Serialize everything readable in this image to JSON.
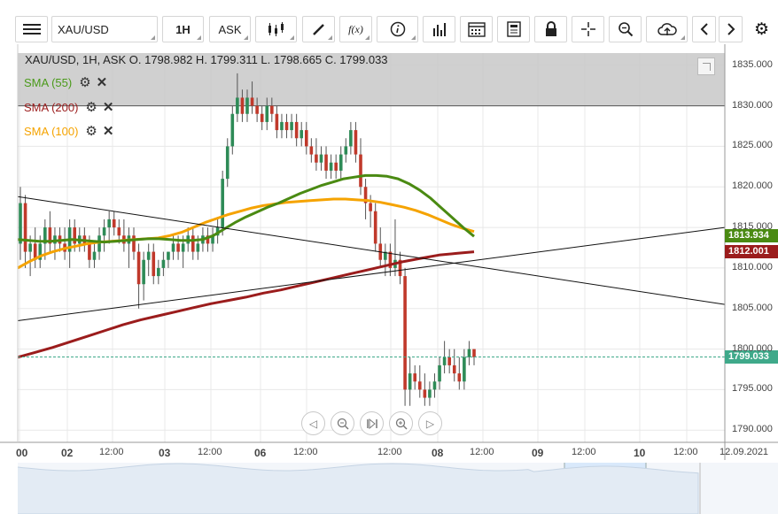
{
  "toolbar": {
    "symbol": "XAU/USD",
    "timeframe": "1H",
    "price_type": "ASK",
    "fx_label": "f(x)"
  },
  "chart_header": {
    "info": "XAU/USD, 1H, ASK   O. 1798.982 H. 1799.311 L. 1798.665 C. 1799.033"
  },
  "indicators": [
    {
      "label": "SMA (55)",
      "color": "#4a9a1a"
    },
    {
      "label": "SMA (200)",
      "color": "#9b1c1c"
    },
    {
      "label": "SMA (100)",
      "color": "#f5a300"
    }
  ],
  "price_badges": [
    {
      "label": "1813.934",
      "value": 1813.934,
      "color": "#4a8a12"
    },
    {
      "label": "1812.001",
      "value": 1812.001,
      "color": "#9b1c1c"
    },
    {
      "label": "1799.033",
      "value": 1799.033,
      "color": "#3fa98a"
    }
  ],
  "colors": {
    "bull_candle": "#2e8b57",
    "bear_candle": "#c0392b",
    "trendline": "#111111",
    "shaded_zone": "#c8c8c8",
    "grid": "#e8e8e8"
  },
  "chart_data": {
    "type": "candlestick",
    "symbol": "XAU/USD",
    "timeframe": "1H",
    "y_ticks": [
      "1835.000",
      "1830.000",
      "1825.000",
      "1820.000",
      "1815.000",
      "1810.000",
      "1805.000",
      "1800.000",
      "1795.000",
      "1790.000"
    ],
    "ylim": [
      1788.5,
      1836.5
    ],
    "x_ticks": [
      "00",
      "02",
      "12:00",
      "03",
      "12:00",
      "06",
      "12:00",
      "12:00",
      "08",
      "12:00",
      "09",
      "12:00",
      "10",
      "12:00",
      "12.09.2021"
    ],
    "shaded_zone": [
      1830.0,
      1836.5
    ],
    "current_price": 1799.033,
    "candles": [
      {
        "o": 1813,
        "h": 1820,
        "l": 1811,
        "c": 1818
      },
      {
        "o": 1818,
        "h": 1819,
        "l": 1810,
        "c": 1812
      },
      {
        "o": 1812,
        "h": 1814,
        "l": 1809,
        "c": 1813
      },
      {
        "o": 1813,
        "h": 1815,
        "l": 1810,
        "c": 1811
      },
      {
        "o": 1811,
        "h": 1814,
        "l": 1810,
        "c": 1813
      },
      {
        "o": 1813,
        "h": 1816,
        "l": 1811,
        "c": 1815
      },
      {
        "o": 1815,
        "h": 1817,
        "l": 1812,
        "c": 1813
      },
      {
        "o": 1813,
        "h": 1815,
        "l": 1811,
        "c": 1814
      },
      {
        "o": 1814,
        "h": 1815,
        "l": 1812,
        "c": 1813
      },
      {
        "o": 1813,
        "h": 1815,
        "l": 1811,
        "c": 1812
      },
      {
        "o": 1812,
        "h": 1816,
        "l": 1810,
        "c": 1815
      },
      {
        "o": 1815,
        "h": 1816,
        "l": 1812,
        "c": 1813
      },
      {
        "o": 1813,
        "h": 1815,
        "l": 1812,
        "c": 1814
      },
      {
        "o": 1814,
        "h": 1815,
        "l": 1812,
        "c": 1813
      },
      {
        "o": 1813,
        "h": 1814,
        "l": 1810,
        "c": 1811
      },
      {
        "o": 1811,
        "h": 1813,
        "l": 1810,
        "c": 1812
      },
      {
        "o": 1812,
        "h": 1815,
        "l": 1811,
        "c": 1814
      },
      {
        "o": 1814,
        "h": 1816,
        "l": 1812,
        "c": 1815
      },
      {
        "o": 1815,
        "h": 1817,
        "l": 1813,
        "c": 1816
      },
      {
        "o": 1816,
        "h": 1817,
        "l": 1814,
        "c": 1815
      },
      {
        "o": 1815,
        "h": 1816,
        "l": 1813,
        "c": 1814
      },
      {
        "o": 1814,
        "h": 1816,
        "l": 1812,
        "c": 1813
      },
      {
        "o": 1813,
        "h": 1815,
        "l": 1810,
        "c": 1814
      },
      {
        "o": 1814,
        "h": 1815,
        "l": 1811,
        "c": 1812
      },
      {
        "o": 1812,
        "h": 1813,
        "l": 1805,
        "c": 1808
      },
      {
        "o": 1808,
        "h": 1812,
        "l": 1806,
        "c": 1811
      },
      {
        "o": 1811,
        "h": 1813,
        "l": 1809,
        "c": 1812
      },
      {
        "o": 1812,
        "h": 1813,
        "l": 1808,
        "c": 1809
      },
      {
        "o": 1809,
        "h": 1811,
        "l": 1808,
        "c": 1810
      },
      {
        "o": 1810,
        "h": 1812,
        "l": 1809,
        "c": 1811
      },
      {
        "o": 1811,
        "h": 1812,
        "l": 1810,
        "c": 1812
      },
      {
        "o": 1812,
        "h": 1814,
        "l": 1811,
        "c": 1813
      },
      {
        "o": 1813,
        "h": 1814,
        "l": 1811,
        "c": 1812
      },
      {
        "o": 1812,
        "h": 1814,
        "l": 1810,
        "c": 1813
      },
      {
        "o": 1813,
        "h": 1815,
        "l": 1812,
        "c": 1814
      },
      {
        "o": 1814,
        "h": 1815,
        "l": 1811,
        "c": 1812
      },
      {
        "o": 1812,
        "h": 1814,
        "l": 1811,
        "c": 1813
      },
      {
        "o": 1813,
        "h": 1815,
        "l": 1812,
        "c": 1814
      },
      {
        "o": 1814,
        "h": 1815,
        "l": 1812,
        "c": 1813
      },
      {
        "o": 1813,
        "h": 1815,
        "l": 1812,
        "c": 1814
      },
      {
        "o": 1814,
        "h": 1816,
        "l": 1813,
        "c": 1815
      },
      {
        "o": 1815,
        "h": 1822,
        "l": 1814,
        "c": 1821
      },
      {
        "o": 1821,
        "h": 1826,
        "l": 1820,
        "c": 1825
      },
      {
        "o": 1825,
        "h": 1830,
        "l": 1824,
        "c": 1829
      },
      {
        "o": 1829,
        "h": 1834,
        "l": 1828,
        "c": 1831
      },
      {
        "o": 1831,
        "h": 1832,
        "l": 1828,
        "c": 1829
      },
      {
        "o": 1829,
        "h": 1832,
        "l": 1828,
        "c": 1831
      },
      {
        "o": 1831,
        "h": 1833,
        "l": 1829,
        "c": 1830
      },
      {
        "o": 1830,
        "h": 1831,
        "l": 1828,
        "c": 1829
      },
      {
        "o": 1829,
        "h": 1830,
        "l": 1827,
        "c": 1828
      },
      {
        "o": 1828,
        "h": 1831,
        "l": 1827,
        "c": 1830
      },
      {
        "o": 1830,
        "h": 1831,
        "l": 1828,
        "c": 1829
      },
      {
        "o": 1829,
        "h": 1830,
        "l": 1826,
        "c": 1827
      },
      {
        "o": 1827,
        "h": 1829,
        "l": 1826,
        "c": 1828
      },
      {
        "o": 1828,
        "h": 1829,
        "l": 1826,
        "c": 1827
      },
      {
        "o": 1827,
        "h": 1829,
        "l": 1826,
        "c": 1828
      },
      {
        "o": 1828,
        "h": 1829,
        "l": 1825,
        "c": 1826
      },
      {
        "o": 1826,
        "h": 1828,
        "l": 1825,
        "c": 1827
      },
      {
        "o": 1827,
        "h": 1828,
        "l": 1824,
        "c": 1825
      },
      {
        "o": 1825,
        "h": 1826,
        "l": 1823,
        "c": 1824
      },
      {
        "o": 1824,
        "h": 1826,
        "l": 1822,
        "c": 1823
      },
      {
        "o": 1823,
        "h": 1825,
        "l": 1822,
        "c": 1824
      },
      {
        "o": 1824,
        "h": 1825,
        "l": 1821,
        "c": 1822
      },
      {
        "o": 1822,
        "h": 1824,
        "l": 1821,
        "c": 1823
      },
      {
        "o": 1823,
        "h": 1824,
        "l": 1821,
        "c": 1822
      },
      {
        "o": 1822,
        "h": 1825,
        "l": 1821,
        "c": 1824
      },
      {
        "o": 1824,
        "h": 1826,
        "l": 1823,
        "c": 1825
      },
      {
        "o": 1825,
        "h": 1828,
        "l": 1824,
        "c": 1827
      },
      {
        "o": 1827,
        "h": 1828,
        "l": 1823,
        "c": 1824
      },
      {
        "o": 1824,
        "h": 1826,
        "l": 1819,
        "c": 1820
      },
      {
        "o": 1820,
        "h": 1821,
        "l": 1816,
        "c": 1818
      },
      {
        "o": 1818,
        "h": 1819,
        "l": 1815,
        "c": 1817
      },
      {
        "o": 1817,
        "h": 1818,
        "l": 1812,
        "c": 1813
      },
      {
        "o": 1813,
        "h": 1815,
        "l": 1810,
        "c": 1811
      },
      {
        "o": 1811,
        "h": 1813,
        "l": 1809,
        "c": 1812
      },
      {
        "o": 1812,
        "h": 1813,
        "l": 1809,
        "c": 1810
      },
      {
        "o": 1810,
        "h": 1816,
        "l": 1809,
        "c": 1811
      },
      {
        "o": 1811,
        "h": 1812,
        "l": 1808,
        "c": 1809
      },
      {
        "o": 1809,
        "h": 1810,
        "l": 1793,
        "c": 1795
      },
      {
        "o": 1795,
        "h": 1799,
        "l": 1793,
        "c": 1797
      },
      {
        "o": 1797,
        "h": 1798,
        "l": 1795,
        "c": 1796
      },
      {
        "o": 1796,
        "h": 1798,
        "l": 1794,
        "c": 1795
      },
      {
        "o": 1795,
        "h": 1797,
        "l": 1793,
        "c": 1794
      },
      {
        "o": 1794,
        "h": 1796,
        "l": 1793,
        "c": 1795
      },
      {
        "o": 1795,
        "h": 1797,
        "l": 1794,
        "c": 1796
      },
      {
        "o": 1796,
        "h": 1799,
        "l": 1795,
        "c": 1798
      },
      {
        "o": 1798,
        "h": 1801,
        "l": 1797,
        "c": 1799
      },
      {
        "o": 1799,
        "h": 1800,
        "l": 1797,
        "c": 1798
      },
      {
        "o": 1798,
        "h": 1800,
        "l": 1796,
        "c": 1797
      },
      {
        "o": 1797,
        "h": 1799,
        "l": 1795,
        "c": 1796
      },
      {
        "o": 1796,
        "h": 1800,
        "l": 1795,
        "c": 1799
      },
      {
        "o": 1799,
        "h": 1801,
        "l": 1798,
        "c": 1800
      },
      {
        "o": 1800,
        "h": 1800,
        "l": 1798,
        "c": 1799
      }
    ],
    "sma_55": [
      1813.5,
      1813.4,
      1813.3,
      1813.3,
      1813.4,
      1813.5,
      1813.4,
      1813.3,
      1813.2,
      1813.3,
      1813.4,
      1813.5,
      1813.6,
      1813.6,
      1813.5,
      1813.4,
      1813.4,
      1813.5,
      1814.0,
      1814.8,
      1815.6,
      1816.3,
      1816.9,
      1817.5,
      1818.0,
      1818.6,
      1819.2,
      1819.7,
      1820.2,
      1820.6,
      1821.0,
      1821.2,
      1821.4,
      1821.4,
      1821.3,
      1821.0,
      1820.4,
      1819.6,
      1818.6,
      1817.4,
      1816.2,
      1815.0,
      1813.9
    ],
    "sma_100": [
      1810.0,
      1810.8,
      1811.5,
      1812.0,
      1812.4,
      1812.7,
      1813.0,
      1813.2,
      1813.3,
      1813.4,
      1813.5,
      1813.6,
      1813.7,
      1814.0,
      1814.4,
      1815.0,
      1815.6,
      1816.1,
      1816.6,
      1817.0,
      1817.4,
      1817.7,
      1817.9,
      1818.1,
      1818.2,
      1818.3,
      1818.4,
      1818.5,
      1818.5,
      1818.4,
      1818.3,
      1818.1,
      1817.8,
      1817.5,
      1817.1,
      1816.6,
      1816.0,
      1815.4,
      1814.9,
      1814.5
    ],
    "sma_200": [
      1799.0,
      1799.6,
      1800.2,
      1800.9,
      1801.6,
      1802.3,
      1803.0,
      1803.6,
      1804.1,
      1804.6,
      1805.1,
      1805.6,
      1806.0,
      1806.4,
      1806.9,
      1807.3,
      1807.8,
      1808.3,
      1808.8,
      1809.3,
      1809.8,
      1810.3,
      1810.8,
      1811.2,
      1811.6,
      1811.8,
      1812.0
    ],
    "trendlines": [
      {
        "from": {
          "x": 0,
          "y": 1818.8
        },
        "to": {
          "x": 1,
          "y": 1805.5
        }
      },
      {
        "from": {
          "x": 0,
          "y": 1803.5
        },
        "to": {
          "x": 1,
          "y": 1815.0
        }
      }
    ]
  }
}
